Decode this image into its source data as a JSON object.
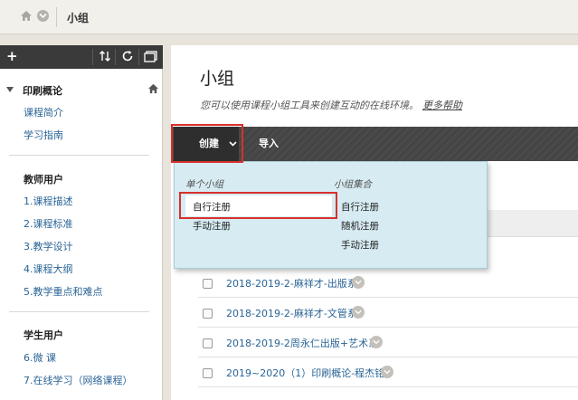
{
  "breadcrumb": {
    "current": "小组"
  },
  "sidebar": {
    "course_title": "印刷概论",
    "top_links": [
      "课程简介",
      "学习指南"
    ],
    "teacher_heading": "教师用户",
    "teacher_links": [
      "1.课程描述",
      "2.课程标准",
      "3.教学设计",
      "4.课程大纲",
      "5.教学重点和难点"
    ],
    "student_heading": "学生用户",
    "student_links": [
      "6.微 课",
      "7.在线学习（网络课程）"
    ]
  },
  "main": {
    "title": "小组",
    "subtitle": "您可以使用课程小组工具来创建互动的在线环境。",
    "help_link": "更多帮助",
    "create_label": "创建",
    "import_label": "导入",
    "groups": [
      "2018-2019-2-麻祥才-出版系",
      "2018-2019-2-麻祥才-文管系",
      "2018-2019-2周永仁出版+艺术系",
      "2019~2020（1）印刷概论-程杰铭"
    ]
  },
  "dropdown": {
    "single_heading": "单个小组",
    "single_items": [
      "自行注册",
      "手动注册"
    ],
    "set_heading": "小组集合",
    "set_items": [
      "自行注册",
      "随机注册",
      "手动注册"
    ]
  },
  "colors": {
    "highlight_red": "#d9302c",
    "link_blue": "#2a6496",
    "dropdown_bg": "#d6ebf2"
  }
}
